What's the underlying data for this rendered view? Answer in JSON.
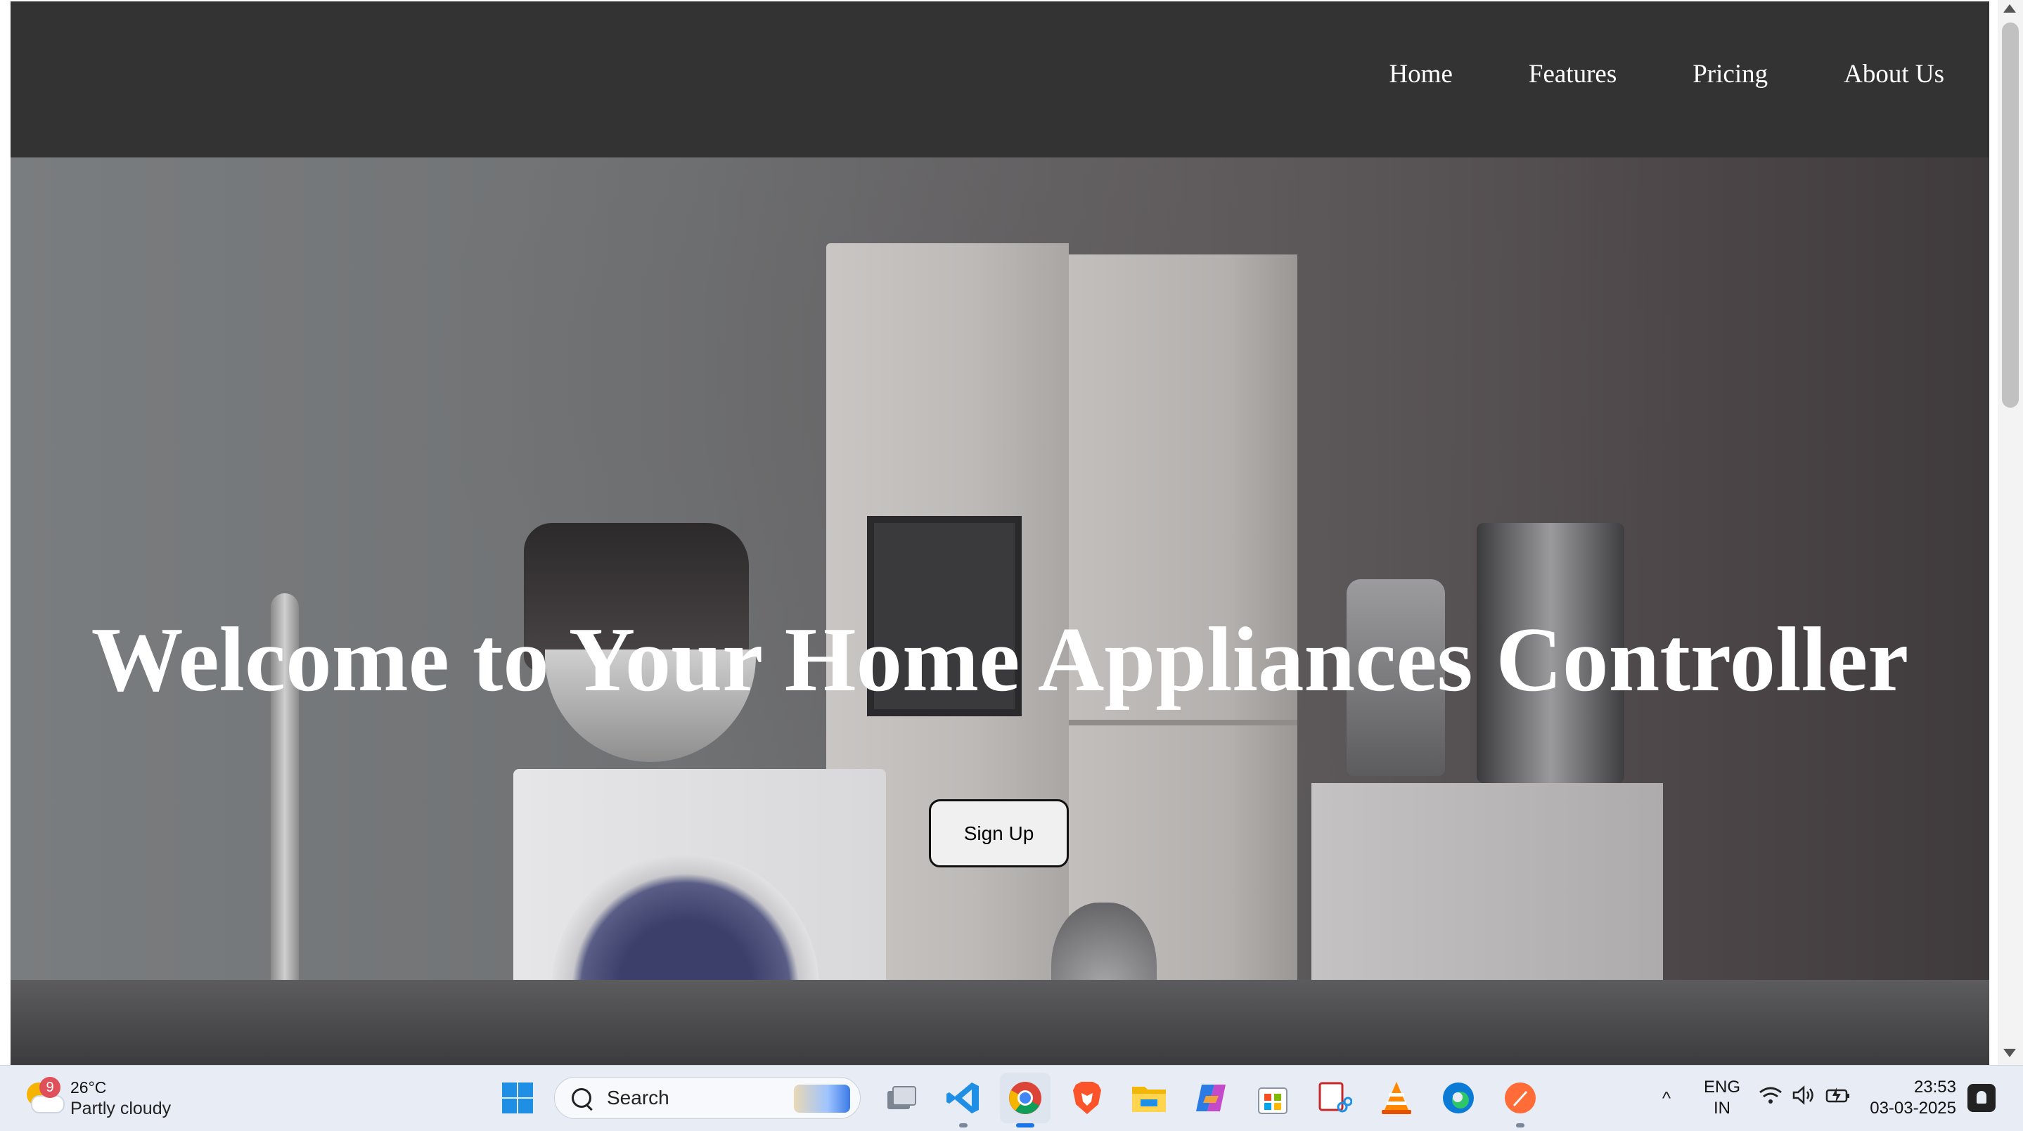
{
  "nav": {
    "items": [
      "Home",
      "Features",
      "Pricing",
      "About Us"
    ]
  },
  "hero": {
    "title": "Welcome to Your Home Appliances Controller",
    "cta_label": "Sign Up",
    "background": "home appliances photo"
  },
  "taskbar": {
    "weather": {
      "badge": "9",
      "temp": "26°C",
      "condition": "Partly cloudy"
    },
    "search_label": "Search",
    "apps": [
      {
        "name": "start-icon",
        "active": false
      },
      {
        "name": "search"
      },
      {
        "name": "task-view-icon",
        "active": false
      },
      {
        "name": "vscode-icon",
        "active": false,
        "running": true
      },
      {
        "name": "chrome-icon",
        "active": true,
        "running": true
      },
      {
        "name": "brave-icon",
        "active": false
      },
      {
        "name": "file-explorer-icon",
        "active": false
      },
      {
        "name": "copilot-icon",
        "active": false
      },
      {
        "name": "microsoft-store-icon",
        "active": false
      },
      {
        "name": "snipping-tool-icon",
        "active": false
      },
      {
        "name": "vlc-icon",
        "active": false
      },
      {
        "name": "edge-icon",
        "active": false
      },
      {
        "name": "postman-icon",
        "active": false,
        "running": true
      }
    ],
    "tray": {
      "lang_line1": "ENG",
      "lang_line2": "IN",
      "time": "23:53",
      "date": "03-03-2025"
    }
  },
  "colors": {
    "navbar_bg": "#333333",
    "nav_text": "#ffffff",
    "taskbar_bg": "#e8edf5",
    "accent": "#1a73e8"
  }
}
